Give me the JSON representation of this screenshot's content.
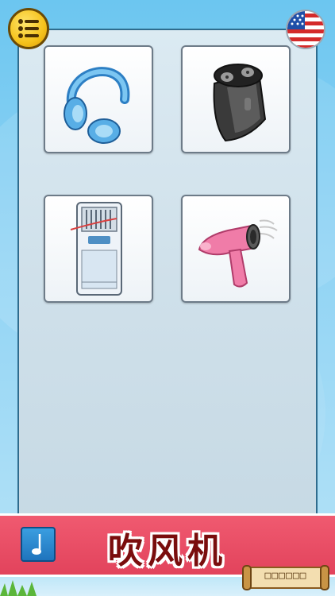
{
  "header": {
    "menu_icon": "list-menu-icon",
    "language_icon": "us-flag-icon"
  },
  "items": [
    {
      "name": "headphones",
      "icon": "headphones-icon"
    },
    {
      "name": "electric-shaver",
      "icon": "shaver-icon"
    },
    {
      "name": "air-conditioner",
      "icon": "air-conditioner-icon"
    },
    {
      "name": "hair-dryer",
      "icon": "hair-dryer-icon"
    }
  ],
  "word_bar": {
    "word": "吹风机",
    "music_icon": "music-note-icon",
    "color": "#e84a62"
  },
  "progress": {
    "text": "□□□□□□",
    "icon": "scroll-icon"
  },
  "colors": {
    "sky": "#7ccbf2",
    "panel": "#d3e3ec",
    "menu_button": "#f5c21b",
    "word_text": "#7a0d0d"
  }
}
